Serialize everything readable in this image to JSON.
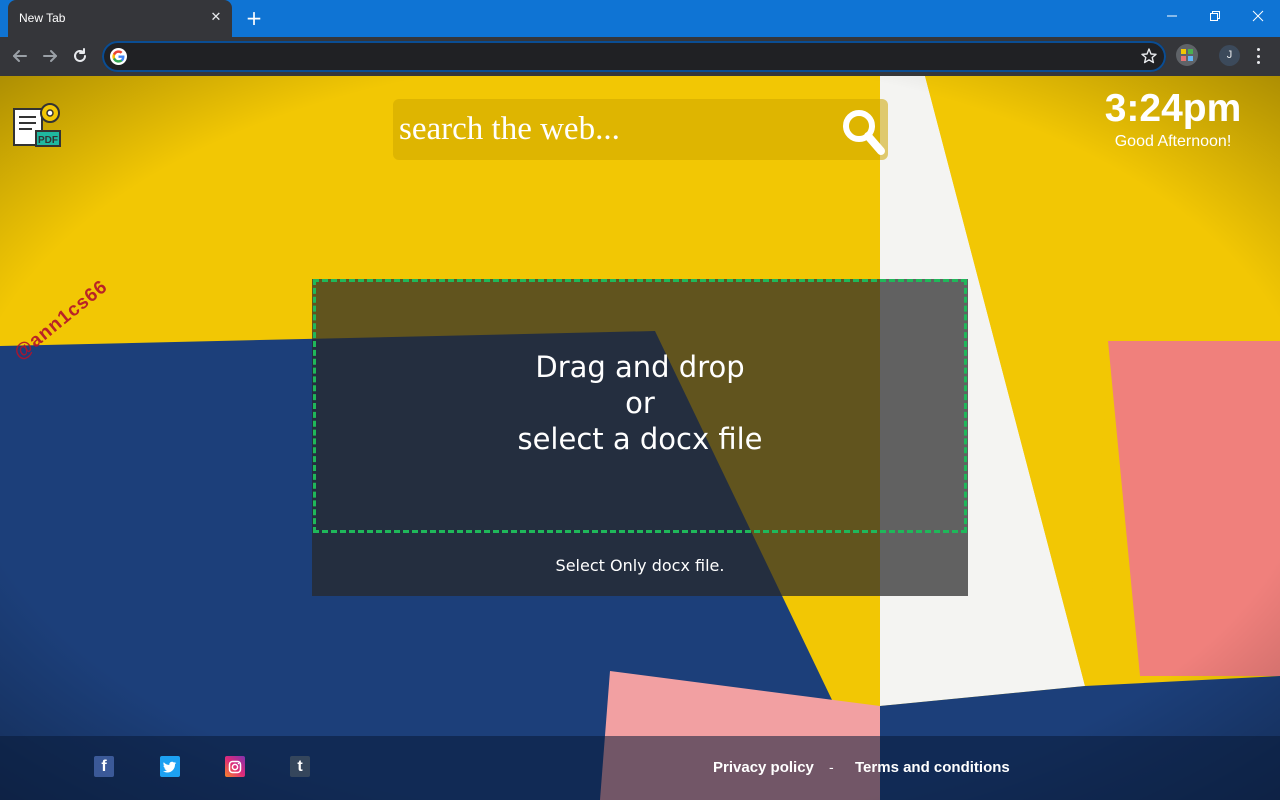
{
  "browser": {
    "tab_title": "New Tab",
    "tab_close": "✕",
    "new_tab": "+",
    "address_value": "",
    "avatar_letter": "J"
  },
  "page": {
    "search": {
      "placeholder": "search the web..."
    },
    "clock": {
      "time": "3:24pm",
      "greeting": "Good Afternoon!"
    },
    "watermark": "@ann1cs66",
    "dropzone": {
      "line1": "Drag and drop",
      "line2": "or",
      "line3": "select a docx file",
      "note": "Select Only docx file."
    },
    "footer": {
      "social": [
        "facebook",
        "twitter",
        "instagram",
        "tumblr"
      ],
      "privacy_label": "Privacy policy",
      "separator": "-",
      "terms_label": "Terms and conditions"
    }
  },
  "colors": {
    "titlebar": "#0f74d4",
    "toolbar": "#35363a",
    "wall_yellow": "#f2c704",
    "wall_blue": "#1c3f7a",
    "wall_pink": "#f0807c",
    "dashed_border": "#1fb85a"
  }
}
